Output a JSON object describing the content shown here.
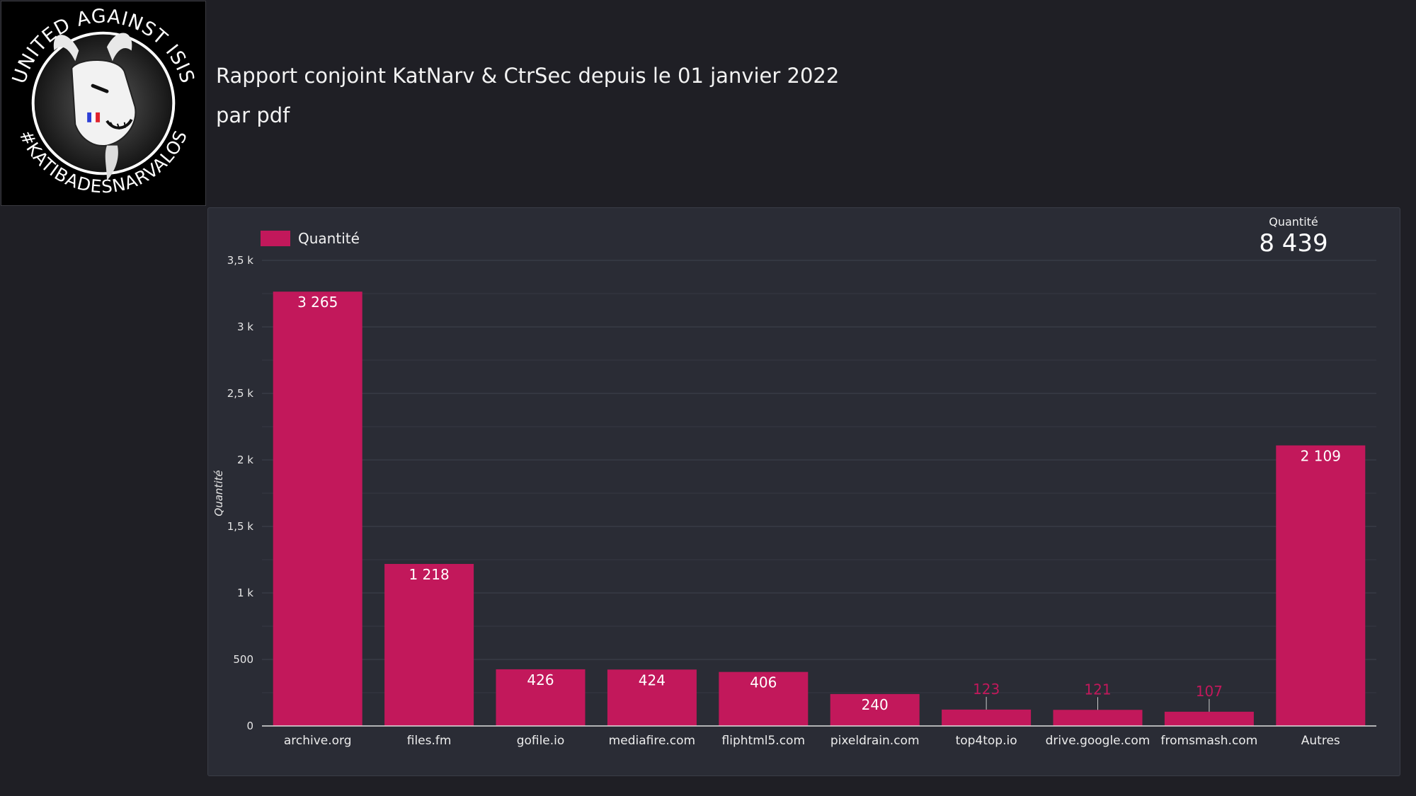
{
  "header": {
    "title": "Rapport conjoint KatNarv & CtrSec depuis le 01 janvier 2022",
    "subtitle": "par pdf"
  },
  "logo": {
    "top_text": "UNITED AGAINST ISIS",
    "bottom_text": "#KATIBADESNARVALOS"
  },
  "kpi": {
    "label": "Quantité",
    "value": "8 439"
  },
  "colors": {
    "bar": "#c2185b",
    "background": "#1f1f25",
    "panel": "#2a2c35",
    "grid": "#3f424d"
  },
  "chart_data": {
    "type": "bar",
    "legend": "top-left",
    "ylabel": "Quantité",
    "ylim": [
      0,
      3500
    ],
    "yticks": [
      {
        "value": 0,
        "label": "0"
      },
      {
        "value": 500,
        "label": "500"
      },
      {
        "value": 1000,
        "label": "1 k"
      },
      {
        "value": 1500,
        "label": "1,5 k"
      },
      {
        "value": 2000,
        "label": "2 k"
      },
      {
        "value": 2500,
        "label": "2,5 k"
      },
      {
        "value": 3000,
        "label": "3 k"
      },
      {
        "value": 3500,
        "label": "3,5 k"
      }
    ],
    "grid": true,
    "categories": [
      "archive.org",
      "files.fm",
      "gofile.io",
      "mediafire.com",
      "fliphtml5.com",
      "pixeldrain.com",
      "top4top.io",
      "drive.google.com",
      "fromsmash.com",
      "Autres"
    ],
    "series": [
      {
        "name": "Quantité",
        "values": [
          3265,
          1218,
          426,
          424,
          406,
          240,
          123,
          121,
          107,
          2109
        ],
        "labels": [
          "3 265",
          "1 218",
          "426",
          "424",
          "406",
          "240",
          "123",
          "121",
          "107",
          "2 109"
        ]
      }
    ]
  }
}
